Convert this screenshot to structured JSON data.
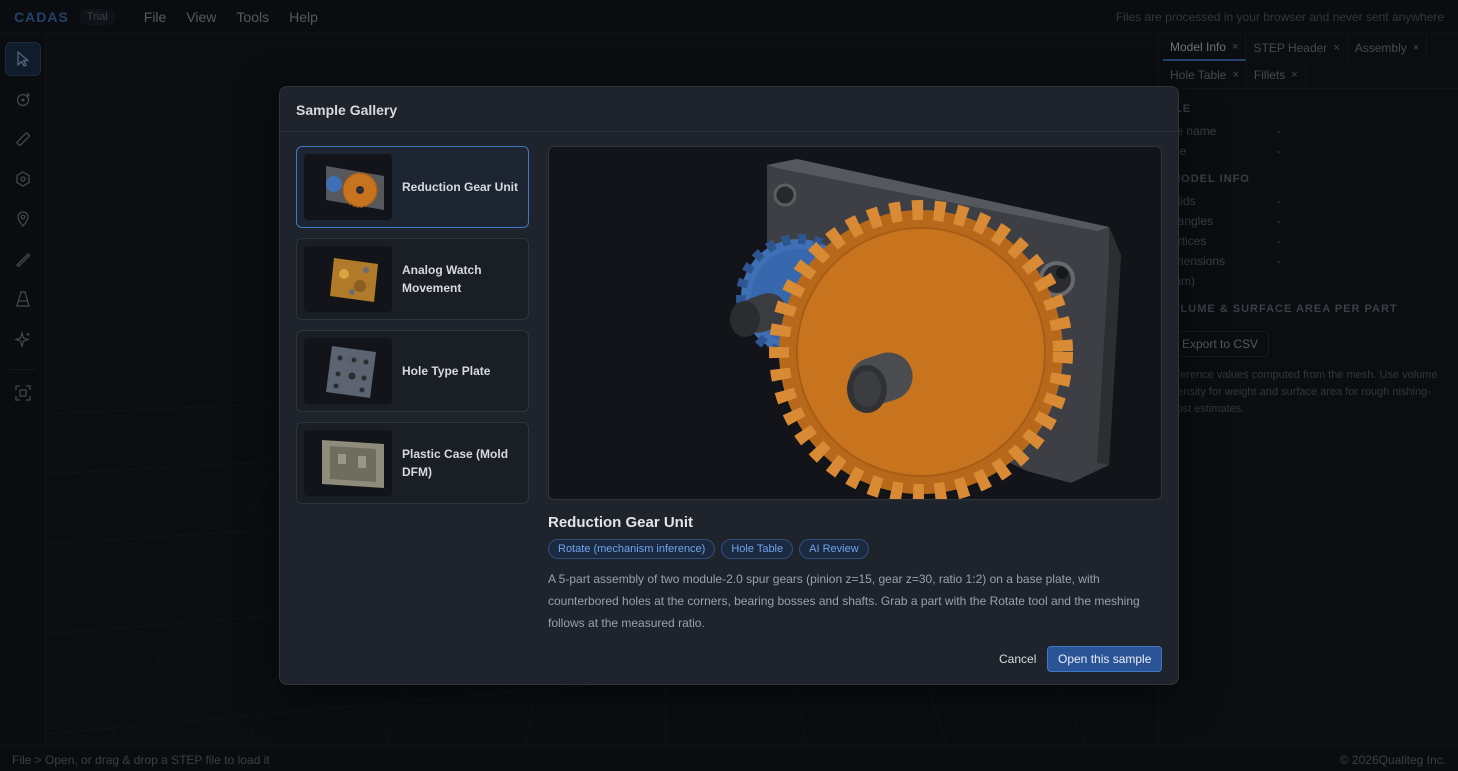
{
  "app": {
    "logo": "CADAS",
    "badge": "Trial",
    "note": "Files are processed in your browser and never sent anywhere"
  },
  "menu": [
    "File",
    "View",
    "Tools",
    "Help"
  ],
  "toolbar": {
    "tools": [
      "select-icon",
      "rotate-icon",
      "measure-icon",
      "hole-icon",
      "pin-icon",
      "edge-icon",
      "draft-icon",
      "ai-sparkle-icon",
      "fit-view-icon"
    ]
  },
  "right_panel": {
    "tabs": [
      {
        "label": "Model Info",
        "active": true
      },
      {
        "label": "STEP Header"
      },
      {
        "label": "Assembly"
      },
      {
        "label": "Hole Table"
      },
      {
        "label": "Fillets"
      }
    ],
    "close_glyph": "×",
    "file_section": "ILE",
    "file_rows": [
      {
        "k": "ile name",
        "v": "-"
      },
      {
        "k": "ize",
        "v": "-"
      }
    ],
    "model_section": "MODEL INFO",
    "model_rows": [
      {
        "k": "olids",
        "v": "-"
      },
      {
        "k": "riangles",
        "v": "-"
      },
      {
        "k": "ertices",
        "v": "-"
      },
      {
        "k": "imensions",
        "v": "-"
      }
    ],
    "dim_unit": "mm)",
    "volume_section": "OLUME & SURFACE AREA PER PART",
    "export_label": "Export to CSV",
    "note": "eference values computed from the mesh. Use volume density for weight and surface area for rough nishing-cost estimates."
  },
  "status": {
    "left": "File > Open, or drag & drop a STEP file to load it",
    "right": "© 2026Qualiteg Inc."
  },
  "modal": {
    "title": "Sample Gallery",
    "samples": [
      {
        "name": "Reduction Gear Unit",
        "selected": true
      },
      {
        "name": "Analog Watch Movement"
      },
      {
        "name": "Hole Type Plate"
      },
      {
        "name": "Plastic Case (Mold DFM)"
      }
    ],
    "detail": {
      "title": "Reduction Gear Unit",
      "tags": [
        "Rotate (mechanism inference)",
        "Hole Table",
        "AI Review"
      ],
      "description": "A 5-part assembly of two module-2.0 spur gears (pinion z=15, gear z=30, ratio 1:2) on a base plate, with counterbored holes at the corners, bearing bosses and shafts. Grab a part with the Rotate tool and the meshing follows at the measured ratio."
    },
    "cancel_label": "Cancel",
    "open_label": "Open this sample"
  },
  "colors": {
    "accent": "#3f78c4",
    "gear_orange": "#c8741f",
    "gear_blue": "#3f6fb5",
    "plate": "#4a4d52"
  }
}
